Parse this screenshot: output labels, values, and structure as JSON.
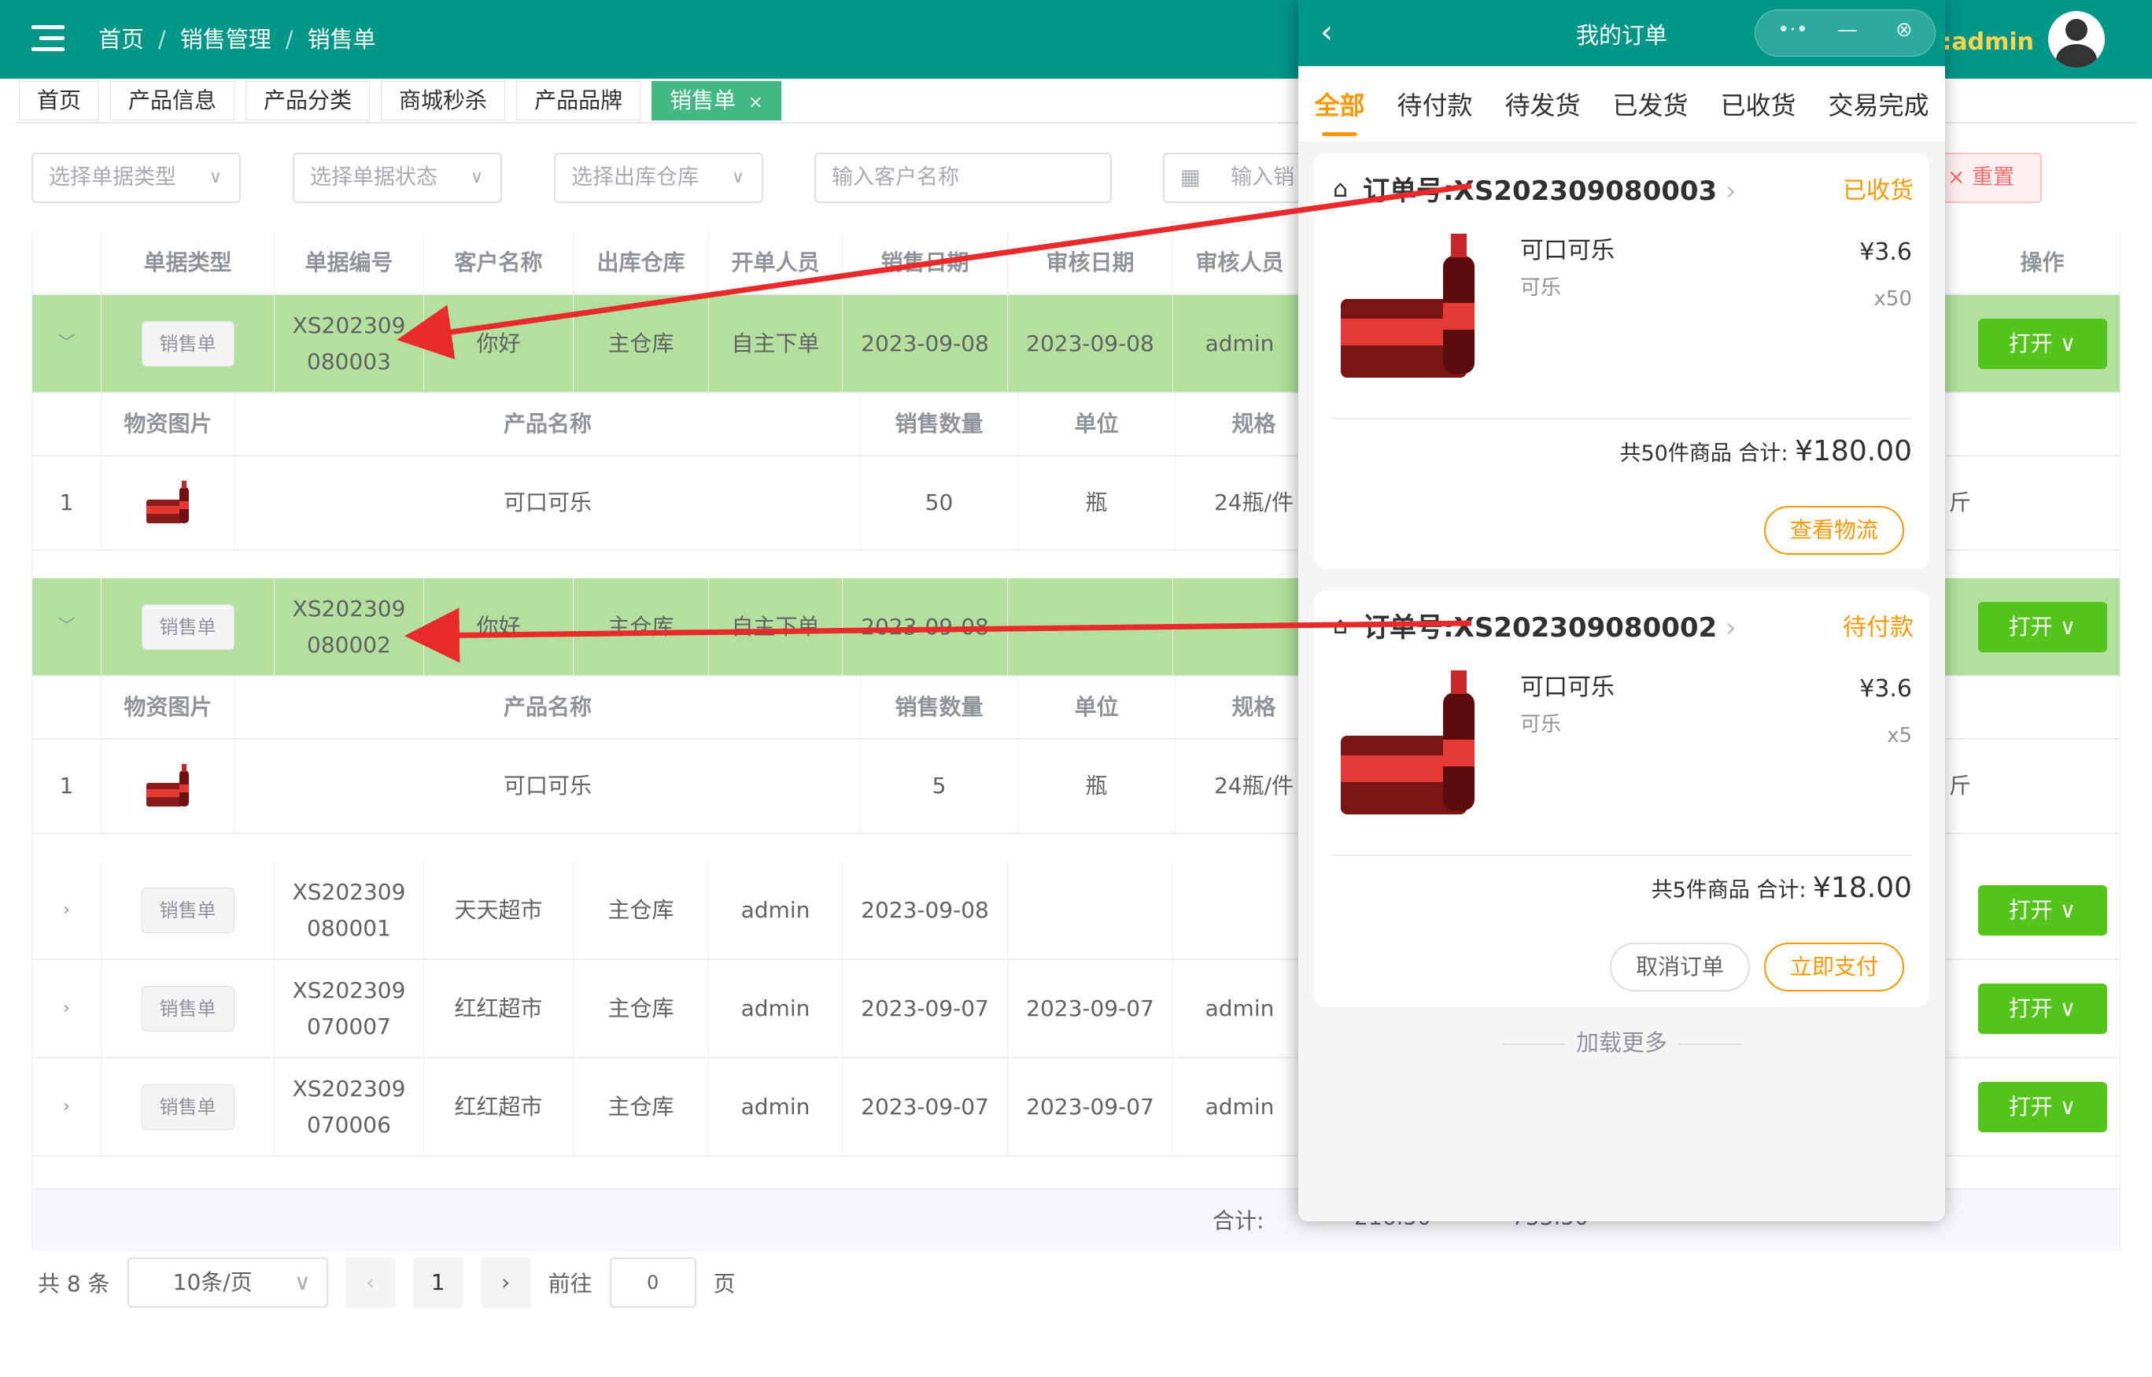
{
  "breadcrumb": {
    "home": "首页",
    "section": "销售管理",
    "page": "销售单",
    "sep": "/"
  },
  "user": {
    "prefix": "名:",
    "name": "admin"
  },
  "tabs": [
    {
      "label": "首页"
    },
    {
      "label": "产品信息"
    },
    {
      "label": "产品分类"
    },
    {
      "label": "商城秒杀"
    },
    {
      "label": "产品品牌"
    },
    {
      "label": "销售单",
      "close": "×"
    }
  ],
  "filters": {
    "type": "选择单据类型",
    "status": "选择单据状态",
    "warehouse": "选择出库仓库",
    "customer": "输入客户名称",
    "date": "输入销",
    "reset": "重置"
  },
  "table": {
    "headers": [
      "单据类型",
      "单据编号",
      "客户名称",
      "出库仓库",
      "开单人员",
      "销售日期",
      "审核日期",
      "审核人员",
      "操作"
    ],
    "detail_headers": [
      "物资图片",
      "产品名称",
      "销售数量",
      "单位",
      "规格"
    ],
    "rows": [
      {
        "type": "销售单",
        "no1": "XS202309",
        "no2": "080003",
        "customer": "你好",
        "warehouse": "主仓库",
        "creator": "自主下单",
        "sale_date": "2023-09-08",
        "audit_date": "2023-09-08",
        "auditor": "admin",
        "action": "打开",
        "expanded": true,
        "detail": {
          "idx": "1",
          "name": "可口可乐",
          "qty": "50",
          "unit": "瓶",
          "spec": "24瓶/件",
          "extra": "斤"
        }
      },
      {
        "type": "销售单",
        "no1": "XS202309",
        "no2": "080002",
        "customer": "你好",
        "warehouse": "主仓库",
        "creator": "自主下单",
        "sale_date": "2023-09-08",
        "audit_date": "",
        "auditor": "",
        "action": "打开",
        "expanded": true,
        "detail": {
          "idx": "1",
          "name": "可口可乐",
          "qty": "5",
          "unit": "瓶",
          "spec": "24瓶/件",
          "extra": "斤"
        }
      },
      {
        "type": "销售单",
        "no1": "XS202309",
        "no2": "080001",
        "customer": "天天超市",
        "warehouse": "主仓库",
        "creator": "admin",
        "sale_date": "2023-09-08",
        "audit_date": "",
        "auditor": "",
        "action": "打开"
      },
      {
        "type": "销售单",
        "no1": "XS202309",
        "no2": "070007",
        "customer": "红红超市",
        "warehouse": "主仓库",
        "creator": "admin",
        "sale_date": "2023-09-07",
        "audit_date": "2023-09-07",
        "auditor": "admin",
        "action": "打开"
      },
      {
        "type": "销售单",
        "no1": "XS202309",
        "no2": "070006",
        "customer": "红红超市",
        "warehouse": "主仓库",
        "creator": "admin",
        "sale_date": "2023-09-07",
        "audit_date": "2023-09-07",
        "auditor": "admin",
        "action": "打开"
      }
    ],
    "total_label": "合计:",
    "total_a": "216.50",
    "total_b": "733.50"
  },
  "pagination": {
    "total": "共 8 条",
    "size": "10条/页",
    "page": "1",
    "goto": "前往",
    "goto_value": "0",
    "page_suffix": "页"
  },
  "phone": {
    "title": "我的订单",
    "tabs": [
      "全部",
      "待付款",
      "待发货",
      "已发货",
      "已收货",
      "交易完成"
    ],
    "orders": [
      {
        "label": "订单号:",
        "no": "XS202309080003",
        "status": "已收货",
        "product": "可口可乐",
        "spec": "可乐",
        "price": "¥3.6",
        "qty": "x50",
        "count": "共50件商品 合计:",
        "total": "¥180.00",
        "buttons": [
          "查看物流"
        ]
      },
      {
        "label": "订单号:",
        "no": "XS202309080002",
        "status": "待付款",
        "product": "可口可乐",
        "spec": "可乐",
        "price": "¥3.6",
        "qty": "x5",
        "count": "共5件商品 合计:",
        "total": "¥18.00",
        "buttons": [
          "取消订单",
          "立即支付"
        ]
      }
    ],
    "load_more": "加载更多"
  },
  "colors": {
    "primary": "#009688",
    "accent": "#ff9800",
    "row_highlight": "#b3e19d",
    "button_green": "#52c41a",
    "arrow": "#e82a2a"
  }
}
